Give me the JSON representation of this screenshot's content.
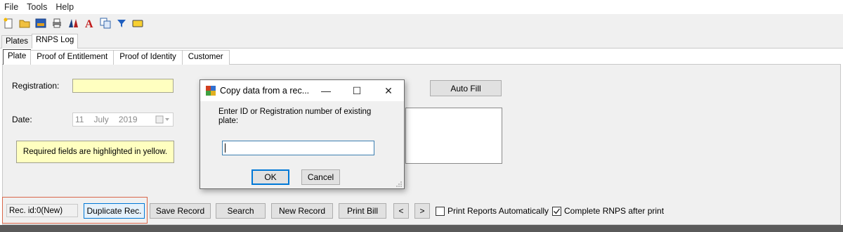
{
  "menu": {
    "file": "File",
    "tools": "Tools",
    "help": "Help"
  },
  "toolbar": {
    "icons": [
      "new-file-icon",
      "open-folder-icon",
      "image-icon",
      "print-icon",
      "compare-icon",
      "font-icon",
      "copy-icon",
      "filter-icon",
      "rectangle-icon"
    ]
  },
  "outer_tabs": {
    "plates": "Plates",
    "rnps_log": "RNPS Log",
    "active": "RNPS Log"
  },
  "inner_tabs": {
    "plate": "Plate",
    "proof_entitlement": "Proof of Entitlement",
    "proof_identity": "Proof of Identity",
    "customer": "Customer",
    "active": "Plate"
  },
  "form": {
    "registration_label": "Registration:",
    "registration_value": "",
    "date_label": "Date:",
    "date_day": "11",
    "date_month": "July",
    "date_year": "2019",
    "required_note": "Required fields are highlighted in yellow.",
    "auto_fill": "Auto Fill"
  },
  "dialog": {
    "title": "Copy data from a rec...",
    "prompt": "Enter ID or Registration number of existing plate:",
    "input_value": "",
    "ok": "OK",
    "cancel": "Cancel",
    "minimize_glyph": "—",
    "maximize_glyph": "☐",
    "close_glyph": "✕"
  },
  "bottom": {
    "rec_id": "Rec. id:0(New)",
    "duplicate": "Duplicate Rec.",
    "save": "Save Record",
    "search": "Search",
    "new_record": "New Record",
    "print_bill": "Print Bill",
    "prev": "<",
    "next": ">",
    "print_reports_auto": "Print Reports Automatically",
    "print_reports_checked": false,
    "complete_rnps": "Complete RNPS after print",
    "complete_rnps_checked": true
  },
  "colors": {
    "required_yellow": "#ffffc0",
    "highlight_border": "#d9664a",
    "focus_blue": "#3c7fb1"
  }
}
